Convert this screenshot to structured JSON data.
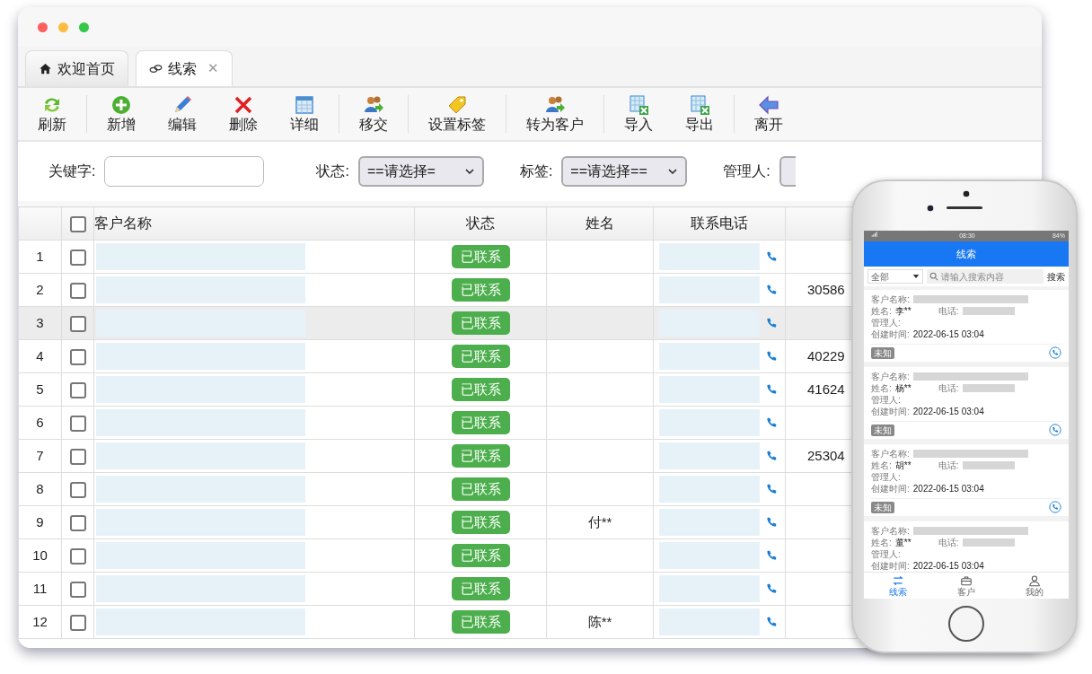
{
  "window": {
    "controls": [
      {
        "color": "#fc605c"
      },
      {
        "color": "#fdbc40"
      },
      {
        "color": "#34c84a"
      }
    ]
  },
  "tabs": [
    {
      "label": "欢迎首页",
      "selected": false
    },
    {
      "label": "线索",
      "selected": true,
      "close": "✕"
    }
  ],
  "toolbar": [
    [
      "刷新"
    ],
    [
      "新增",
      "编辑",
      "删除",
      "详细"
    ],
    [
      "移交"
    ],
    [
      "设置标签"
    ],
    [
      "转为客户"
    ],
    [
      "导入",
      "导出"
    ],
    [
      "离开"
    ]
  ],
  "filters": [
    {
      "label": "关键字:",
      "kind": "text"
    },
    {
      "label": "状态:",
      "kind": "select",
      "value": "==请选择="
    },
    {
      "label": "标签:",
      "kind": "select",
      "value": "==请选择=="
    },
    {
      "label": "管理人:",
      "kind": "select"
    }
  ],
  "table": {
    "header_checked": false,
    "columns": [
      "客户名称",
      "状态",
      "姓名",
      "联系电话"
    ],
    "rows": [
      {
        "index": "1",
        "checked": false,
        "selected": false,
        "status": "已联系"
      },
      {
        "index": "2",
        "checked": false,
        "selected": false,
        "status": "已联系",
        "column_7": "30586"
      },
      {
        "index": "3",
        "checked": false,
        "selected": true,
        "status": "已联系"
      },
      {
        "index": "4",
        "checked": false,
        "selected": false,
        "status": "已联系",
        "column_7": "40229"
      },
      {
        "index": "5",
        "checked": false,
        "selected": false,
        "status": "已联系",
        "column_7": "41624"
      },
      {
        "index": "6",
        "checked": false,
        "selected": false,
        "status": "已联系"
      },
      {
        "index": "7",
        "checked": false,
        "selected": false,
        "status": "已联系",
        "column_7": "25304"
      },
      {
        "index": "8",
        "checked": false,
        "selected": false,
        "status": "已联系"
      },
      {
        "index": "9",
        "checked": false,
        "selected": false,
        "status": "已联系",
        "name": "付**"
      },
      {
        "index": "10",
        "checked": false,
        "selected": false,
        "status": "已联系"
      },
      {
        "index": "11",
        "checked": false,
        "selected": false,
        "status": "已联系"
      },
      {
        "index": "12",
        "checked": false,
        "selected": false,
        "status": "已联系",
        "name": "陈**"
      }
    ]
  },
  "mobile": {
    "status_bar": {
      "time": "08:30",
      "battery": "84%"
    },
    "title": "线索",
    "filter": "全部",
    "search": {
      "placeholder": "请输入搜索内容",
      "button": "搜索"
    },
    "cards": [
      {
        "customer_label": "客户名称:",
        "name_label": "姓名:",
        "name": "李**",
        "phone_label": "电话:",
        "manager_label": "管理人:",
        "created_label": "创建时间:",
        "created": "2022-06-15 03:04",
        "badge": "未知"
      },
      {
        "customer_label": "客户名称:",
        "name_label": "姓名:",
        "name": "杨**",
        "phone_label": "电话:",
        "manager_label": "管理人:",
        "created_label": "创建时间:",
        "created": "2022-06-15 03:04",
        "badge": "未知"
      },
      {
        "customer_label": "客户名称:",
        "name_label": "姓名:",
        "name": "胡**",
        "phone_label": "电话:",
        "manager_label": "管理人:",
        "created_label": "创建时间:",
        "created": "2022-06-15 03:04",
        "badge": "未知"
      },
      {
        "customer_label": "客户名称:",
        "name_label": "姓名:",
        "name": "董**",
        "phone_label": "电话:",
        "manager_label": "管理人:",
        "created_label": "创建时间:",
        "created": "2022-06-15 03:04"
      }
    ],
    "tabs": [
      {
        "label": "线索",
        "selected": true
      },
      {
        "label": "客户",
        "selected": false
      },
      {
        "label": "我的",
        "selected": false
      }
    ]
  }
}
